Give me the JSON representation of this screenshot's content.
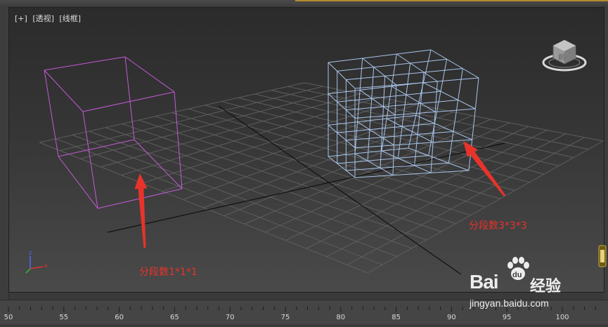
{
  "viewport": {
    "labels": [
      "[+]",
      "[透视]",
      "[线框]"
    ],
    "viewcube_face": "前"
  },
  "annotations": {
    "left": "分段数1*1*1",
    "right": "分段数3*3*3"
  },
  "timeline": {
    "tick_labels": [
      "50",
      "55",
      "60",
      "65",
      "70",
      "75",
      "80",
      "85",
      "90",
      "95",
      "100"
    ]
  },
  "watermark": {
    "brand_bai": "Bai",
    "brand_du": "du",
    "brand_jingyan": "经验",
    "url": "jingyan.baidu.com"
  },
  "colors": {
    "box_left_wire": "#c45ad6",
    "box_right_wire": "#a8c4ea",
    "grid": "#5e5e5e",
    "axis": "#111111",
    "annotation": "#e8332a"
  },
  "icons": [
    "viewcube-icon",
    "axis-gizmo-icon",
    "arrow-icon",
    "paw-icon",
    "lantern-icon"
  ]
}
